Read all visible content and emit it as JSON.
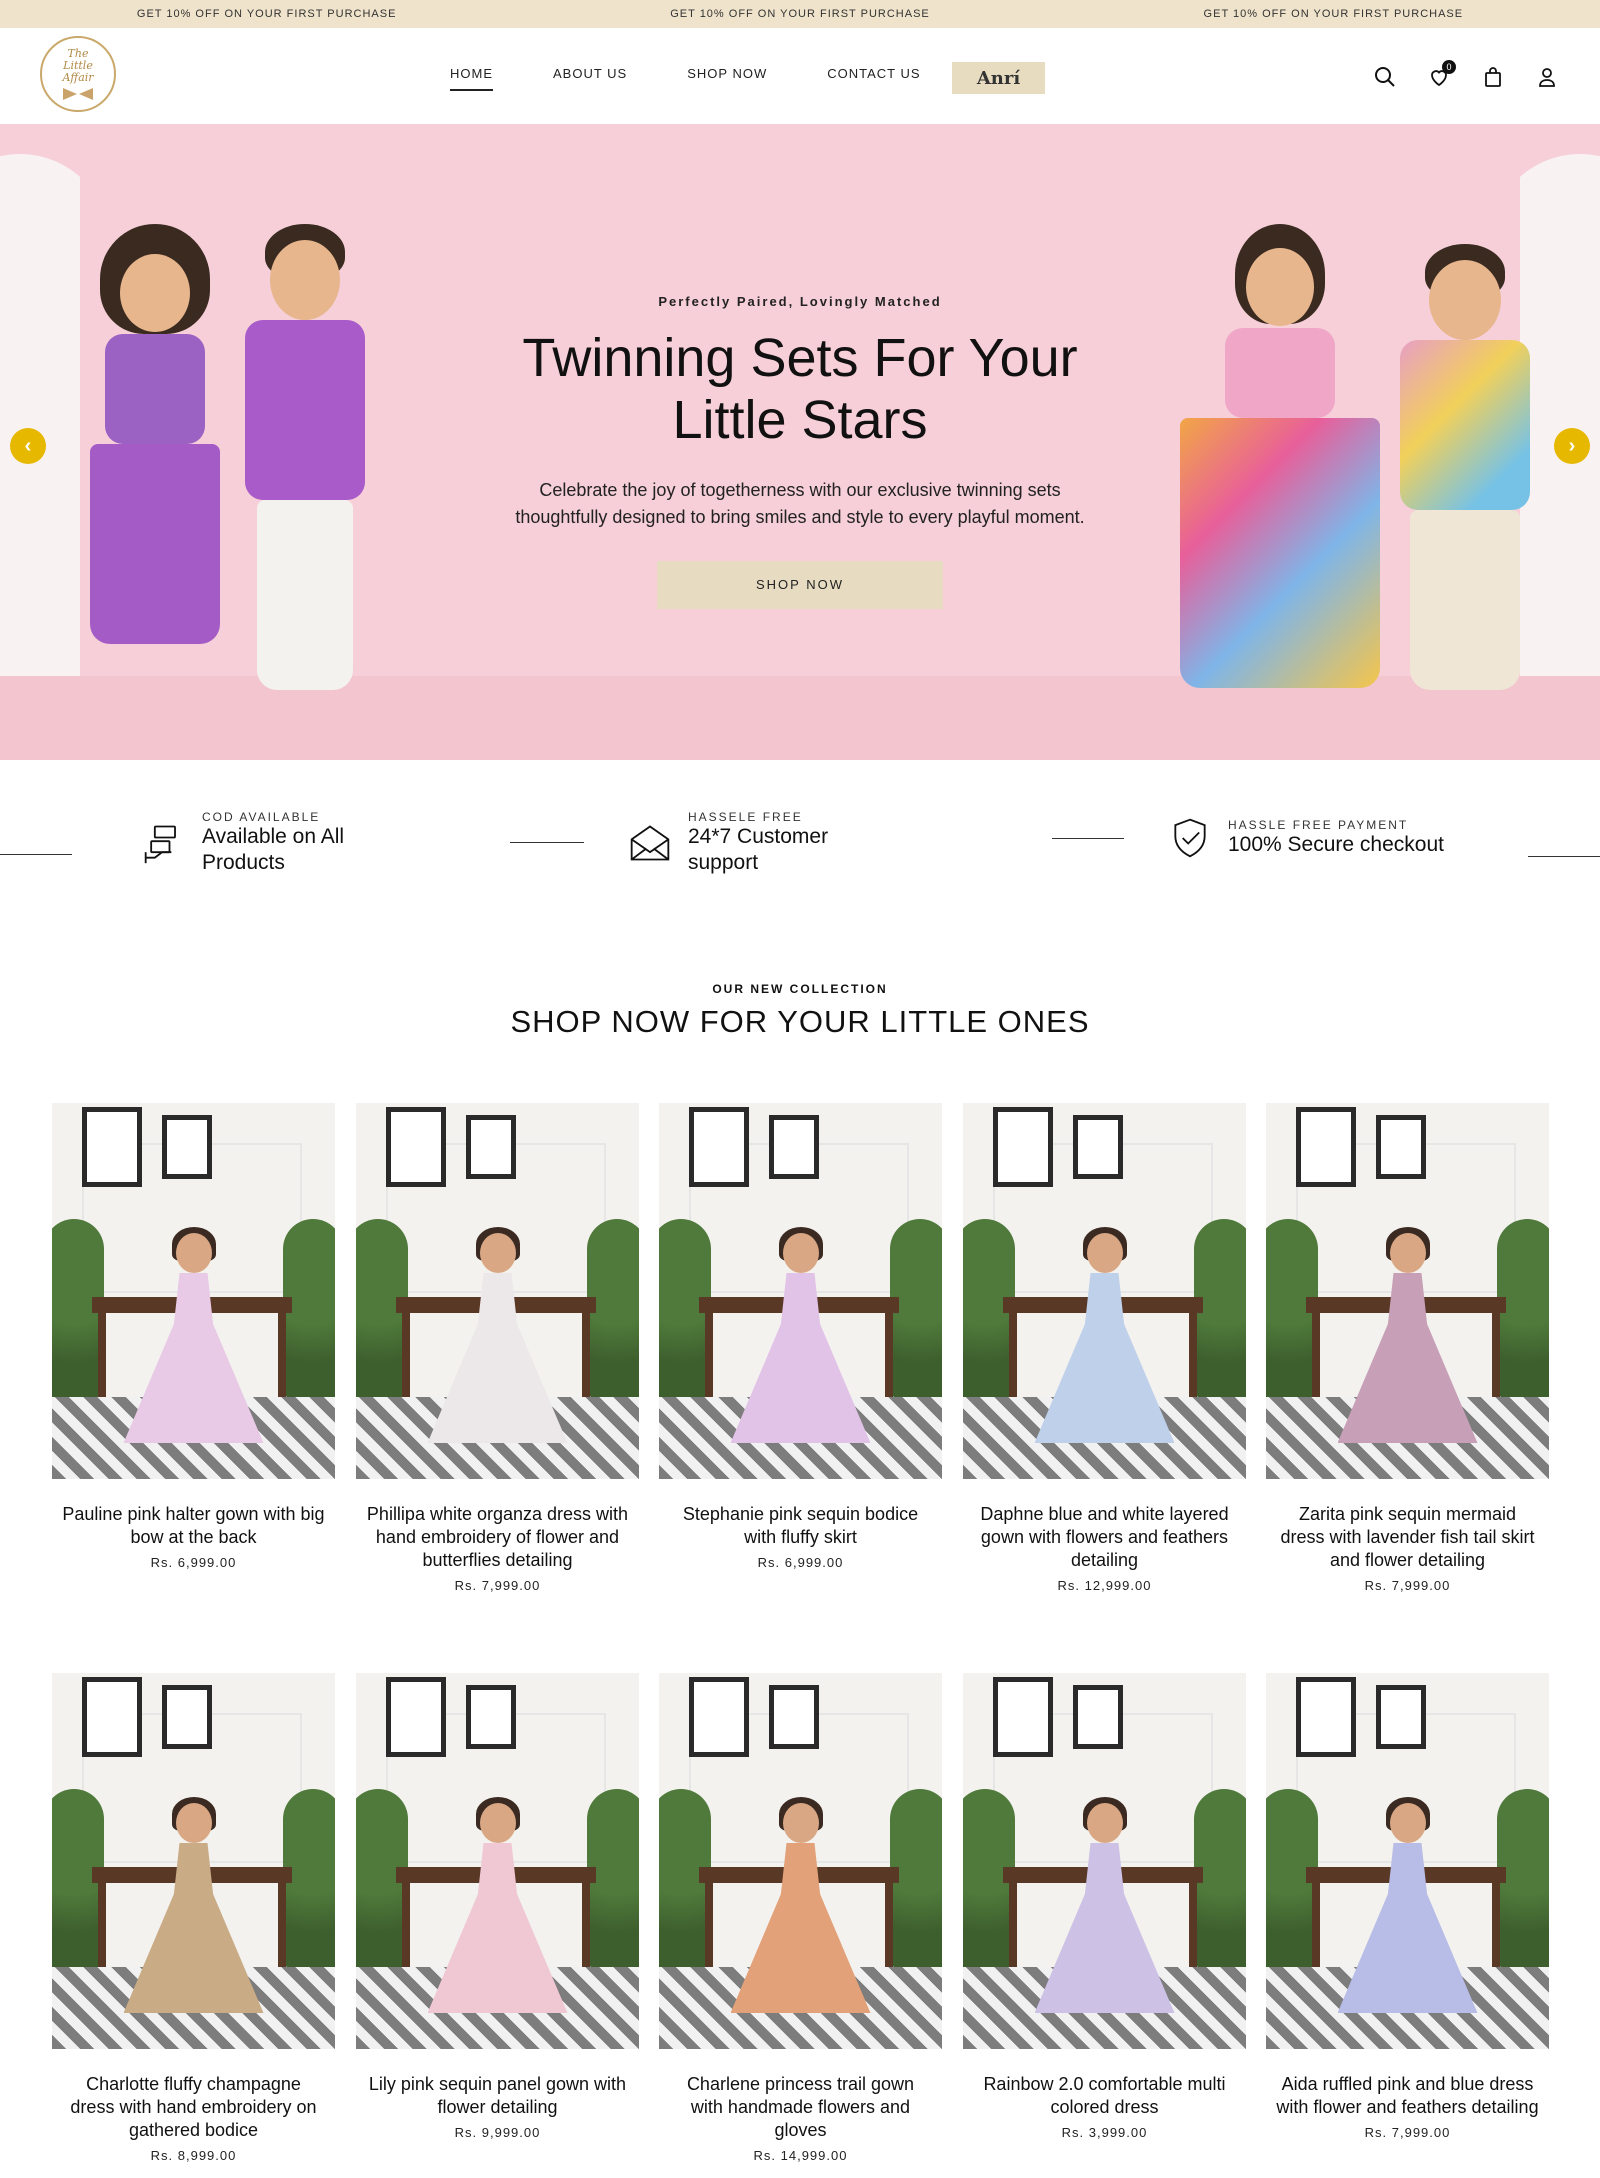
{
  "announcement": {
    "messages": [
      "GET 10% OFF ON YOUR FIRST PURCHASE",
      "GET 10% OFF ON YOUR FIRST PURCHASE",
      "GET 10% OFF ON YOUR FIRST PURCHASE"
    ]
  },
  "header": {
    "logo": {
      "line1": "The",
      "line2": "Little",
      "line3": "Affair"
    },
    "nav": [
      {
        "label": "HOME",
        "active": true
      },
      {
        "label": "ABOUT US",
        "active": false
      },
      {
        "label": "SHOP NOW",
        "active": false
      },
      {
        "label": "CONTACT US",
        "active": false
      }
    ],
    "brand_tag": "Anrí",
    "icons": [
      "search-icon",
      "wishlist-icon",
      "bag-icon",
      "account-icon"
    ],
    "wishlist_count": "0"
  },
  "hero": {
    "eyebrow": "Perfectly Paired, Lovingly Matched",
    "title_line1": "Twinning Sets For Your",
    "title_line2": "Little Stars",
    "subtitle_line1": "Celebrate the joy of togetherness with our exclusive twinning sets",
    "subtitle_line2": "thoughtfully designed to bring smiles and style to every playful moment.",
    "cta": "SHOP NOW",
    "prev_arrow": "‹",
    "next_arrow": "›",
    "colors": {
      "background": "#f6cfd8",
      "arrow": "#e6b800",
      "cta": "#e7dcc1"
    }
  },
  "features": [
    {
      "label": "COD AVAILABLE",
      "value_line1": "Available on All",
      "value_line2": "Products",
      "icon": "cash-hand-icon"
    },
    {
      "label": "HASSELE FREE",
      "value_line1": "24*7 Customer",
      "value_line2": "support",
      "icon": "envelope-icon"
    },
    {
      "label": "HASSLE FREE PAYMENT",
      "value_line1": "100% Secure checkout",
      "value_line2": "",
      "icon": "shield-check-icon"
    }
  ],
  "collection": {
    "eyebrow": "OUR NEW COLLECTION",
    "title": "SHOP NOW FOR YOUR LITTLE ONES",
    "products": [
      {
        "name": "Pauline pink halter gown with big bow at the back",
        "price": "Rs. 6,999.00",
        "dress_color": "#e8c9e6"
      },
      {
        "name": "Phillipa white organza dress with hand embroidery of flower and butterflies detailing",
        "price": "Rs. 7,999.00",
        "dress_color": "#ece8ea"
      },
      {
        "name": "Stephanie pink sequin bodice with fluffy skirt",
        "price": "Rs. 6,999.00",
        "dress_color": "#e2c3e8"
      },
      {
        "name": "Daphne blue and white layered gown with flowers and feathers detailing",
        "price": "Rs. 12,999.00",
        "dress_color": "#bfd0ea"
      },
      {
        "name": "Zarita pink sequin mermaid dress with lavender fish tail skirt and flower detailing",
        "price": "Rs. 7,999.00",
        "dress_color": "#c7a0b8"
      },
      {
        "name": "Charlotte fluffy champagne dress with hand embroidery on gathered bodice",
        "price": "Rs. 8,999.00",
        "dress_color": "#c9ab86"
      },
      {
        "name": "Lily pink sequin panel gown with flower detailing",
        "price": "Rs. 9,999.00",
        "dress_color": "#efc8d4"
      },
      {
        "name": "Charlene princess trail gown with handmade flowers and gloves",
        "price": "Rs. 14,999.00",
        "dress_color": "#e2a179"
      },
      {
        "name": "Rainbow 2.0 comfortable multi colored dress",
        "price": "Rs. 3,999.00",
        "dress_color": "#cdc1e6"
      },
      {
        "name": "Aida ruffled pink and blue dress with flower and feathers detailing",
        "price": "Rs. 7,999.00",
        "dress_color": "#b7bde6"
      }
    ]
  }
}
